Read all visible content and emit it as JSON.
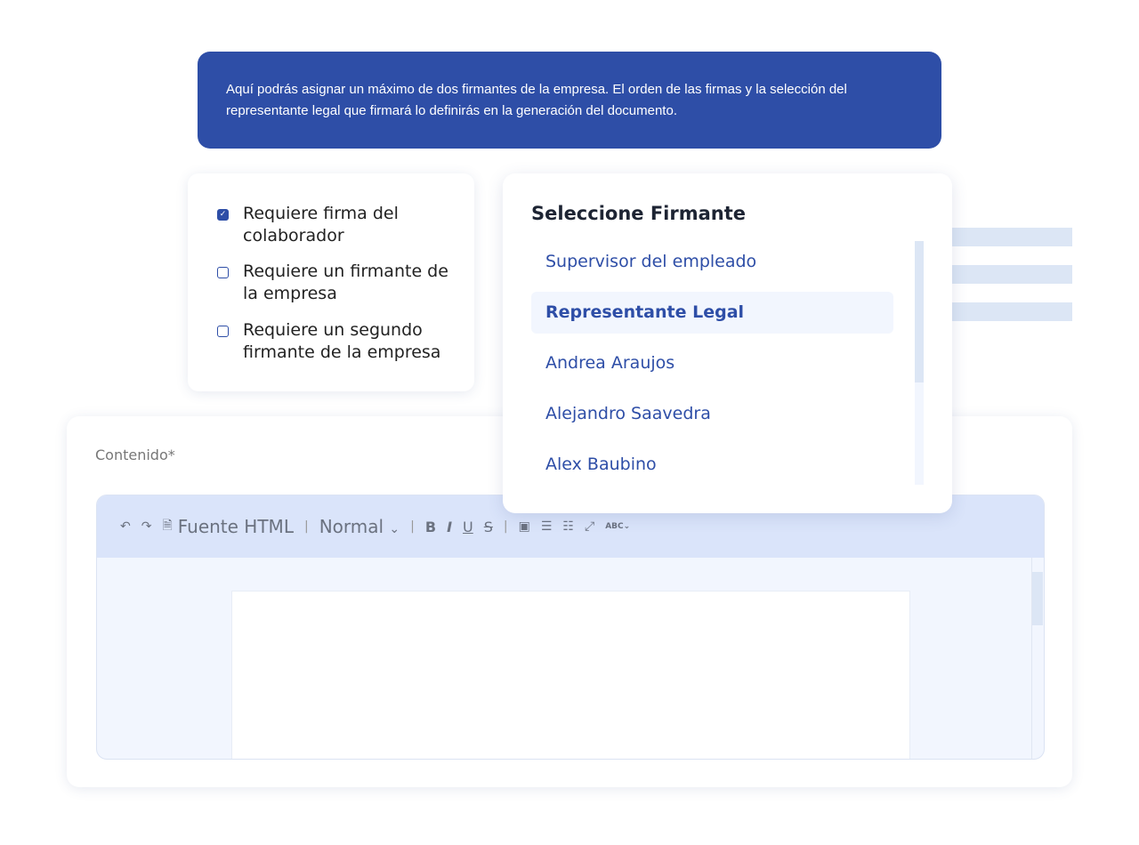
{
  "banner": {
    "text": "Aquí podrás asignar un máximo de dos firmantes de la empresa. El orden de las firmas y la selección del representante legal que firmará lo definirás en la generación del documento."
  },
  "options": [
    {
      "label": "Requiere firma del colaborador",
      "checked": true
    },
    {
      "label": "Requiere un firmante de la empresa",
      "checked": false
    },
    {
      "label": "Requiere un segundo firmante de la empresa",
      "checked": false
    }
  ],
  "editor": {
    "label": "Contenido*",
    "toolbar": {
      "source": "Fuente HTML",
      "format": "Normal",
      "bold": "B",
      "italic": "I",
      "underline": "U",
      "strike": "S",
      "spell": "ABC"
    }
  },
  "dropdown": {
    "title": "Seleccione Firmante",
    "items": [
      {
        "label": "Supervisor del empleado"
      },
      {
        "label": "Representante Legal",
        "selected": true
      },
      {
        "label": "Andrea Araujos"
      },
      {
        "label": "Alejandro Saavedra"
      },
      {
        "label": "Alex Baubino"
      }
    ]
  },
  "colors": {
    "primary": "#2e4ea7",
    "light": "#dae4fa"
  }
}
